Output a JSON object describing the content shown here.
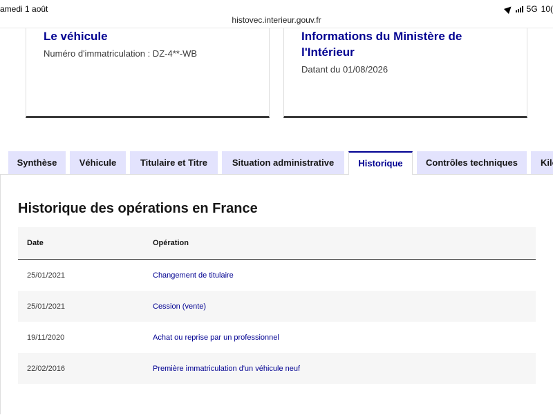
{
  "status_bar": {
    "datetime": "amedi 1 août",
    "network": "5G",
    "battery": "10("
  },
  "url": "histovec.interieur.gouv.fr",
  "cards": {
    "vehicle": {
      "title": "Le véhicule",
      "description": "Numéro d'immatriculation : DZ-4**-WB"
    },
    "ministry": {
      "title": "Informations du Ministère de l'Intérieur",
      "description": "Datant du 01/08/2026"
    }
  },
  "tabs": [
    {
      "label": "Synthèse"
    },
    {
      "label": "Véhicule"
    },
    {
      "label": "Titulaire et Titre"
    },
    {
      "label": "Situation administrative"
    },
    {
      "label": "Historique"
    },
    {
      "label": "Contrôles techniques"
    },
    {
      "label": "Kilo"
    }
  ],
  "active_tab": "Historique",
  "history": {
    "title": "Historique des opérations en France",
    "columns": {
      "date": "Date",
      "operation": "Opération"
    },
    "rows": [
      {
        "date": "25/01/2021",
        "operation": "Changement de titulaire"
      },
      {
        "date": "25/01/2021",
        "operation": "Cession (vente)"
      },
      {
        "date": "19/11/2020",
        "operation": "Achat ou reprise par un professionnel"
      },
      {
        "date": "22/02/2016",
        "operation": "Première immatriculation d'un véhicule neuf"
      }
    ]
  },
  "colors": {
    "brand_blue": "#000091",
    "tab_bg": "#e3e3fd",
    "row_alt_bg": "#f6f6f6"
  }
}
